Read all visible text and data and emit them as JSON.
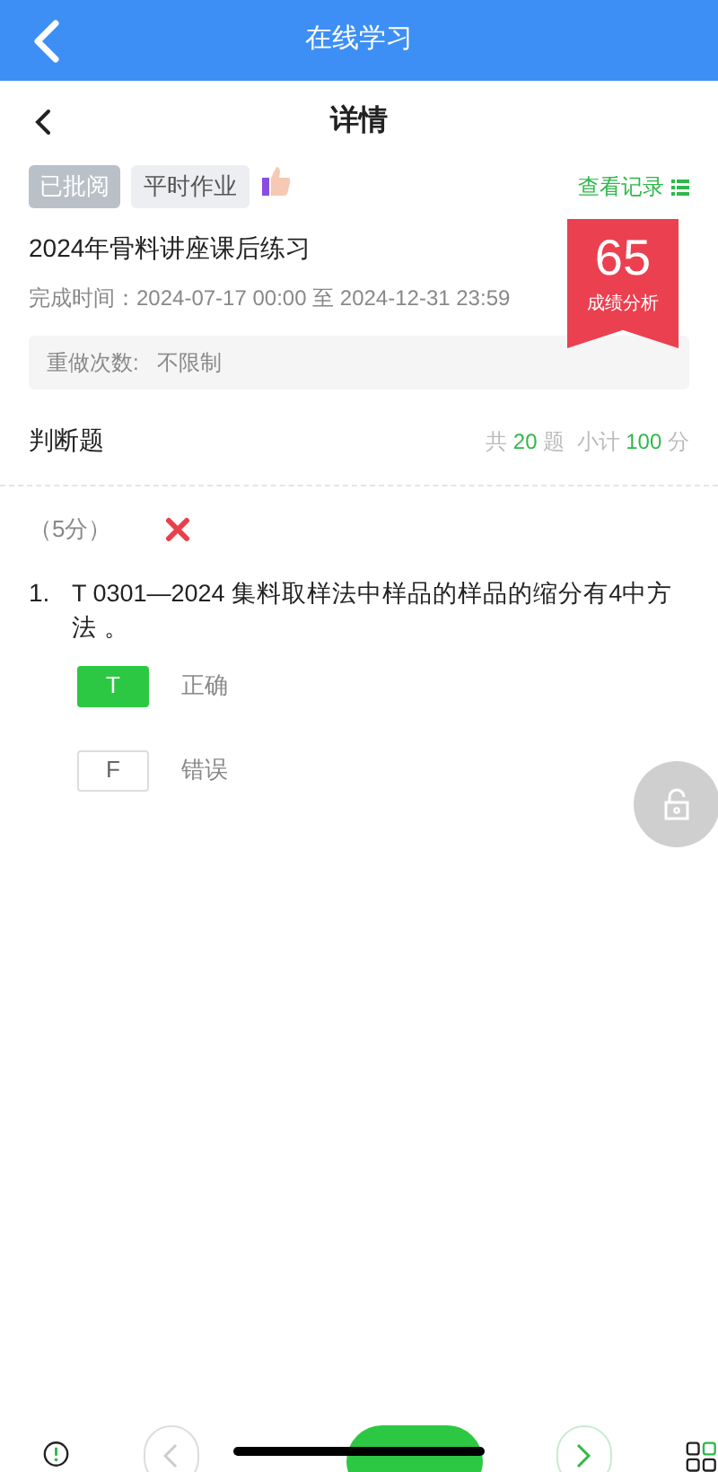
{
  "app_bar": {
    "title": "在线学习"
  },
  "header": {
    "title": "详情"
  },
  "tags": [
    {
      "label": "已批阅",
      "kind": "status"
    },
    {
      "label": "平时作业",
      "kind": "type"
    }
  ],
  "view_records": "查看记录",
  "exercise": {
    "title": "2024年骨料讲座课后练习",
    "time_label": "完成时间：",
    "time_value": "2024-07-17 00:00 至 2024-12-31 23:59",
    "redo_label": "重做次数:",
    "redo_value": "不限制"
  },
  "score": {
    "value": "65",
    "caption": "成绩分析"
  },
  "section": {
    "title": "判断题",
    "total_prefix": "共",
    "total": "20",
    "total_suffix": "题",
    "subtotal_prefix": "小计",
    "subtotal": "100",
    "subtotal_suffix": "分"
  },
  "question": {
    "points": "（5分）",
    "correct": false,
    "number": "1.",
    "text": "T 0301—2024 集料取样法中样品的样品的缩分有4中方法 。",
    "options": [
      {
        "key": "T",
        "label": "正确",
        "selected": true
      },
      {
        "key": "F",
        "label": "错误",
        "selected": false
      }
    ]
  }
}
